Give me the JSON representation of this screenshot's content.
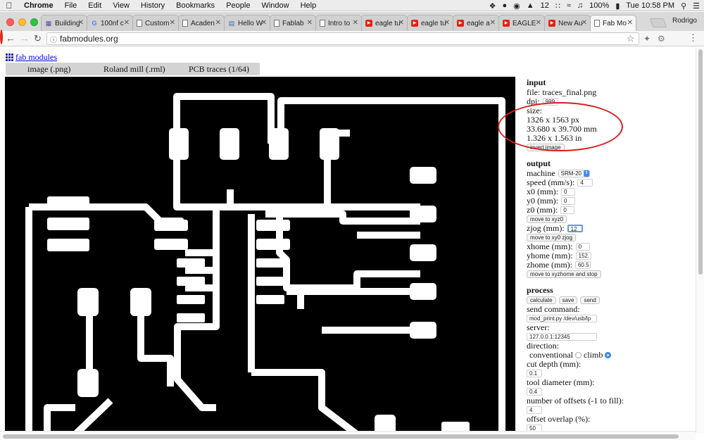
{
  "menubar": {
    "app": "Chrome",
    "items": [
      "File",
      "Edit",
      "View",
      "History",
      "Bookmarks",
      "People",
      "Window",
      "Help"
    ],
    "status": {
      "a_badge": "12",
      "battery": "100%",
      "clock": "Tue 10:58 PM"
    }
  },
  "tabs": [
    {
      "label": "Building",
      "icon": "grid-icon"
    },
    {
      "label": "100nf c",
      "icon": "google-icon"
    },
    {
      "label": "Custom",
      "icon": "doc-icon"
    },
    {
      "label": "Acaden",
      "icon": "doc-icon"
    },
    {
      "label": "Hello W",
      "icon": "book-icon"
    },
    {
      "label": "Fablab",
      "icon": "doc-icon"
    },
    {
      "label": "Intro to",
      "icon": "doc-icon"
    },
    {
      "label": "eagle tu",
      "icon": "youtube-icon"
    },
    {
      "label": "eagle tu",
      "icon": "youtube-icon"
    },
    {
      "label": "eagle a",
      "icon": "youtube-icon"
    },
    {
      "label": "EAGLE",
      "icon": "youtube-icon"
    },
    {
      "label": "New Au",
      "icon": "youtube-icon"
    },
    {
      "label": "Fab Mo",
      "icon": "doc-icon",
      "active": true
    }
  ],
  "profile": "Rodrigo",
  "address": {
    "url": "fabmodules.org"
  },
  "page": {
    "logo_text": "fab modules",
    "modules": [
      "image (.png)",
      "Roland mill (.rml)",
      "PCB traces (1/64)"
    ]
  },
  "panel": {
    "input": {
      "heading": "input",
      "file": "file: traces_final.png",
      "dpi_label": "dpi:",
      "dpi_value": "999.",
      "size_label": "size:",
      "size_px": "1326 x 1563 px",
      "size_mm": "33.680 x 39.700 mm",
      "size_in": "1.326 x 1.563 in",
      "invert_button": "invert image"
    },
    "output": {
      "heading": "output",
      "machine_label": "machine",
      "machine_value": "SRM-20",
      "speed_label": "speed (mm/s):",
      "speed_value": "4",
      "x0_label": "x0 (mm):",
      "x0_value": "0",
      "y0_label": "y0 (mm):",
      "y0_value": "0",
      "z0_label": "z0 (mm):",
      "z0_value": "0",
      "move_xyz0_button": "move to xyz0",
      "zjog_label": "zjog (mm):",
      "zjog_value": "12",
      "move_xy0_zjog_button": "move to xy0 zjog",
      "xhome_label": "xhome (mm):",
      "xhome_value": "0",
      "yhome_label": "yhome (mm):",
      "yhome_value": "152.",
      "zhome_label": "zhome (mm):",
      "zhome_value": "60.5",
      "move_home_button": "move to xyzhome and stop"
    },
    "process": {
      "heading": "process",
      "calculate_button": "calculate",
      "save_button": "save",
      "send_button": "send",
      "send_command_label": "send command:",
      "send_command_value": "mod_print.py /dev/usb/lp",
      "server_label": "server:",
      "server_value": "127.0.0.1:12345",
      "direction_label": "direction:",
      "conventional_label": "conventional",
      "climb_label": "climb",
      "direction_selected": "climb",
      "cut_depth_label": "cut depth (mm):",
      "cut_depth_value": "0.1",
      "tool_diameter_label": "tool diameter (mm):",
      "tool_diameter_value": "0.4",
      "offsets_label": "number of offsets (-1 to fill):",
      "offsets_value": "4",
      "overlap_label": "offset overlap (%):",
      "overlap_value": "50"
    }
  },
  "colors": {
    "annotation": "#d81e1e",
    "pcb_background": "#000000",
    "pcb_traces": "#ffffff"
  }
}
